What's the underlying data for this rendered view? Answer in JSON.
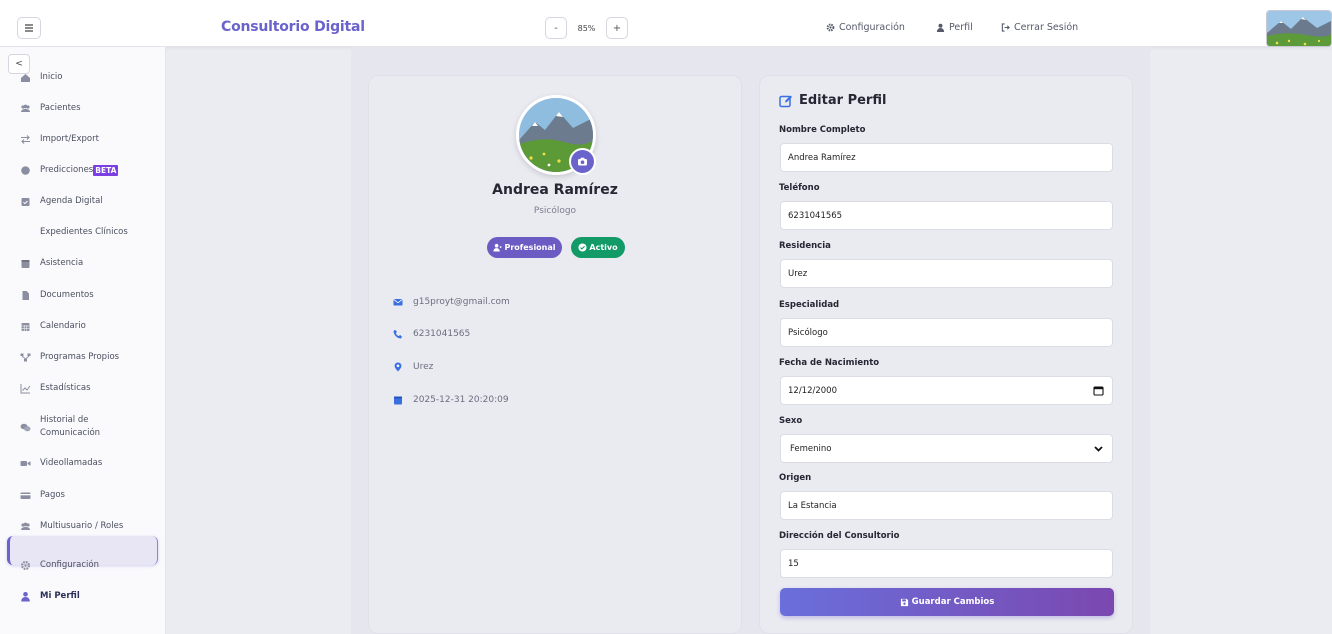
{
  "header": {
    "brand": "Consultorio Digital",
    "zoom_minus": "-",
    "zoom_value": "85%",
    "zoom_plus": "+",
    "nav_config": "Configuración",
    "nav_perfil": "Perfil",
    "nav_logout": "Cerrar Sesión"
  },
  "sidebar": {
    "collapse": "<",
    "items": [
      {
        "label": "Inicio",
        "icon": "home-icon"
      },
      {
        "label": "Pacientes",
        "icon": "users-icon"
      },
      {
        "label": "Import/Export",
        "icon": "exchange-icon"
      },
      {
        "label": "Predicciones",
        "icon": "brain-icon",
        "badge": "BETA"
      },
      {
        "label": "Agenda Digital",
        "icon": "calendar-check-icon"
      },
      {
        "label": "Expedientes Clínicos",
        "icon": ""
      },
      {
        "label": "Asistencia",
        "icon": "calendar-icon"
      },
      {
        "label": "Documentos",
        "icon": "file-icon"
      },
      {
        "label": "Calendario",
        "icon": "calendar-grid-icon"
      },
      {
        "label": "Programas Propios",
        "icon": "sitemap-icon"
      },
      {
        "label": "Estadísticas",
        "icon": "chart-line-icon"
      },
      {
        "label": "Historial de Comunicación",
        "icon": "comments-icon"
      },
      {
        "label": "Videollamadas",
        "icon": "video-icon"
      },
      {
        "label": "Pagos",
        "icon": "credit-card-icon"
      },
      {
        "label": "Multiusuario / Roles",
        "icon": "users-cog-icon"
      },
      {
        "label": "Configuración",
        "icon": "gear-icon"
      },
      {
        "label": "Mi Perfil",
        "icon": "user-icon"
      }
    ]
  },
  "profile": {
    "name": "Andrea Ramírez",
    "role": "Psicólogo",
    "badge_pro": "Profesional",
    "badge_active": "Activo",
    "email": "g15proyt@gmail.com",
    "phone": "6231041565",
    "location": "Urez",
    "date": "2025-12-31 20:20:09"
  },
  "form": {
    "title": "Editar Perfil",
    "fields": [
      {
        "label": "Nombre Completo",
        "value": "Andrea Ramírez"
      },
      {
        "label": "Teléfono",
        "value": "6231041565"
      },
      {
        "label": "Residencia",
        "value": "Urez"
      },
      {
        "label": "Especialidad",
        "value": "Psicólogo"
      },
      {
        "label": "Fecha de Nacimiento",
        "value": "12/12/2000"
      },
      {
        "label": "Sexo",
        "value": "Femenino"
      },
      {
        "label": "Origen",
        "value": "La Estancia"
      },
      {
        "label": "Dirección del Consultorio",
        "value": "15"
      }
    ],
    "save_label": "Guardar Cambios"
  },
  "colors": {
    "accent": "#6a63cc",
    "active_badge": "#129a67",
    "beta": "#7b3fe4"
  }
}
